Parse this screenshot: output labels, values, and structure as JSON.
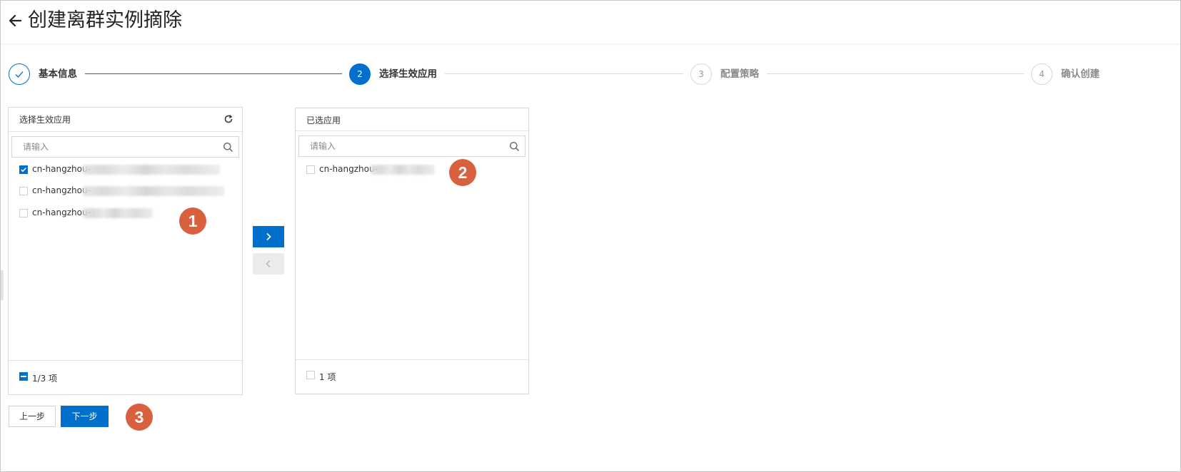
{
  "header": {
    "title": "创建离群实例摘除"
  },
  "steps": [
    {
      "number": "",
      "label": "基本信息",
      "status": "done"
    },
    {
      "number": "2",
      "label": "选择生效应用",
      "status": "active"
    },
    {
      "number": "3",
      "label": "配置策略",
      "status": "pending"
    },
    {
      "number": "4",
      "label": "确认创建",
      "status": "pending"
    }
  ],
  "source_panel": {
    "title": "选择生效应用",
    "search_placeholder": "请输入",
    "items": [
      {
        "label": "cn-hangzhou-",
        "checked": true
      },
      {
        "label": "cn-hangzhou-",
        "checked": false
      },
      {
        "label": "cn-hangzhou-",
        "checked": false
      }
    ],
    "footer": "1/3 项"
  },
  "target_panel": {
    "title": "已选应用",
    "search_placeholder": "请输入",
    "items": [
      {
        "label": "cn-hangzhou-",
        "checked": false
      }
    ],
    "footer": "1 项"
  },
  "buttons": {
    "prev": "上一步",
    "next": "下一步"
  },
  "markers": [
    "1",
    "2",
    "3"
  ],
  "colors": {
    "primary": "#0070cc",
    "marker": "#d9603f",
    "disabled": "#ebebeb"
  },
  "icons": {
    "back": "arrow-left-icon",
    "check": "check-icon",
    "refresh": "refresh-icon",
    "search": "search-icon",
    "transfer_right": "chevron-right-icon",
    "transfer_left": "chevron-left-icon"
  }
}
